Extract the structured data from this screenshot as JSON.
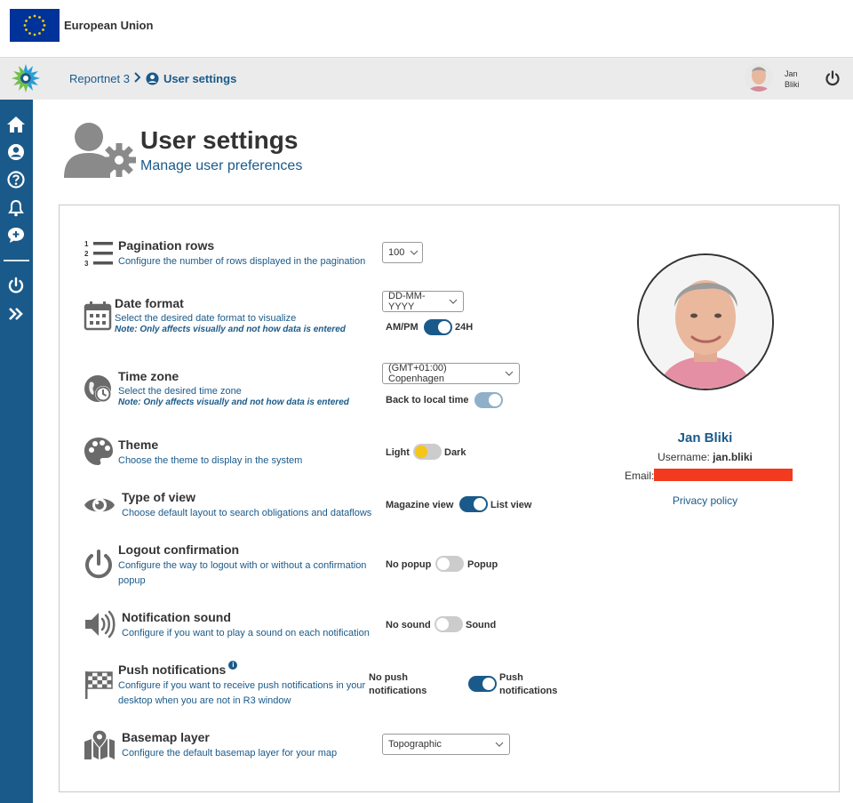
{
  "eu": {
    "title": "European Union"
  },
  "header": {
    "breadcrumb": {
      "root": "Reportnet 3",
      "current": "User settings"
    },
    "user": {
      "first_name": "Jan",
      "last_name": "Bliki"
    }
  },
  "page": {
    "title": "User settings",
    "subtitle": "Manage user preferences"
  },
  "settings": {
    "pagination": {
      "title": "Pagination rows",
      "description": "Configure the number of rows displayed in the pagination",
      "value": "100"
    },
    "date_format": {
      "title": "Date format",
      "description": "Select the desired date format to visualize",
      "note": "Note: Only affects visually and not how data is entered",
      "value": "DD-MM-YYYY",
      "toggle_left": "AM/PM",
      "toggle_right": "24H",
      "toggle_on": true
    },
    "time_zone": {
      "title": "Time zone",
      "description": "Select the desired time zone",
      "note": "Note: Only affects visually and not how data is entered",
      "value": "(GMT+01:00) Copenhagen",
      "toggle_label": "Back to local time",
      "toggle_on": true
    },
    "theme": {
      "title": "Theme",
      "description": "Choose the theme to display in the system",
      "toggle_left": "Light",
      "toggle_right": "Dark",
      "toggle_on": false
    },
    "type_of_view": {
      "title": "Type of view",
      "description": "Choose default layout to search obligations and dataflows",
      "toggle_left": "Magazine view",
      "toggle_right": "List view",
      "toggle_on": true
    },
    "logout_confirmation": {
      "title": "Logout confirmation",
      "description": "Configure the way to logout with or without a confirmation popup",
      "toggle_left": "No popup",
      "toggle_right": "Popup",
      "toggle_on": false
    },
    "notification_sound": {
      "title": "Notification sound",
      "description": "Configure if you want to play a sound on each notification",
      "toggle_left": "No sound",
      "toggle_right": "Sound",
      "toggle_on": false
    },
    "push_notifications": {
      "title": "Push notifications",
      "description": "Configure if you want to receive push notifications in your desktop when you are not in R3 window",
      "toggle_left": "No push notifications",
      "toggle_right": "Push notifications",
      "toggle_on": true
    },
    "basemap": {
      "title": "Basemap layer",
      "description": "Configure the default basemap layer for your map",
      "value": "Topographic"
    }
  },
  "profile": {
    "name": "Jan Bliki",
    "username_label": "Username:",
    "username": "jan.bliki",
    "email_label": "Email:",
    "privacy_link": "Privacy policy"
  },
  "colors": {
    "primary": "#1a5a8a",
    "eu_blue": "#003399",
    "eu_star": "#ffcc00",
    "redaction": "#f23a1f",
    "theme_knob": "#f5c518"
  }
}
